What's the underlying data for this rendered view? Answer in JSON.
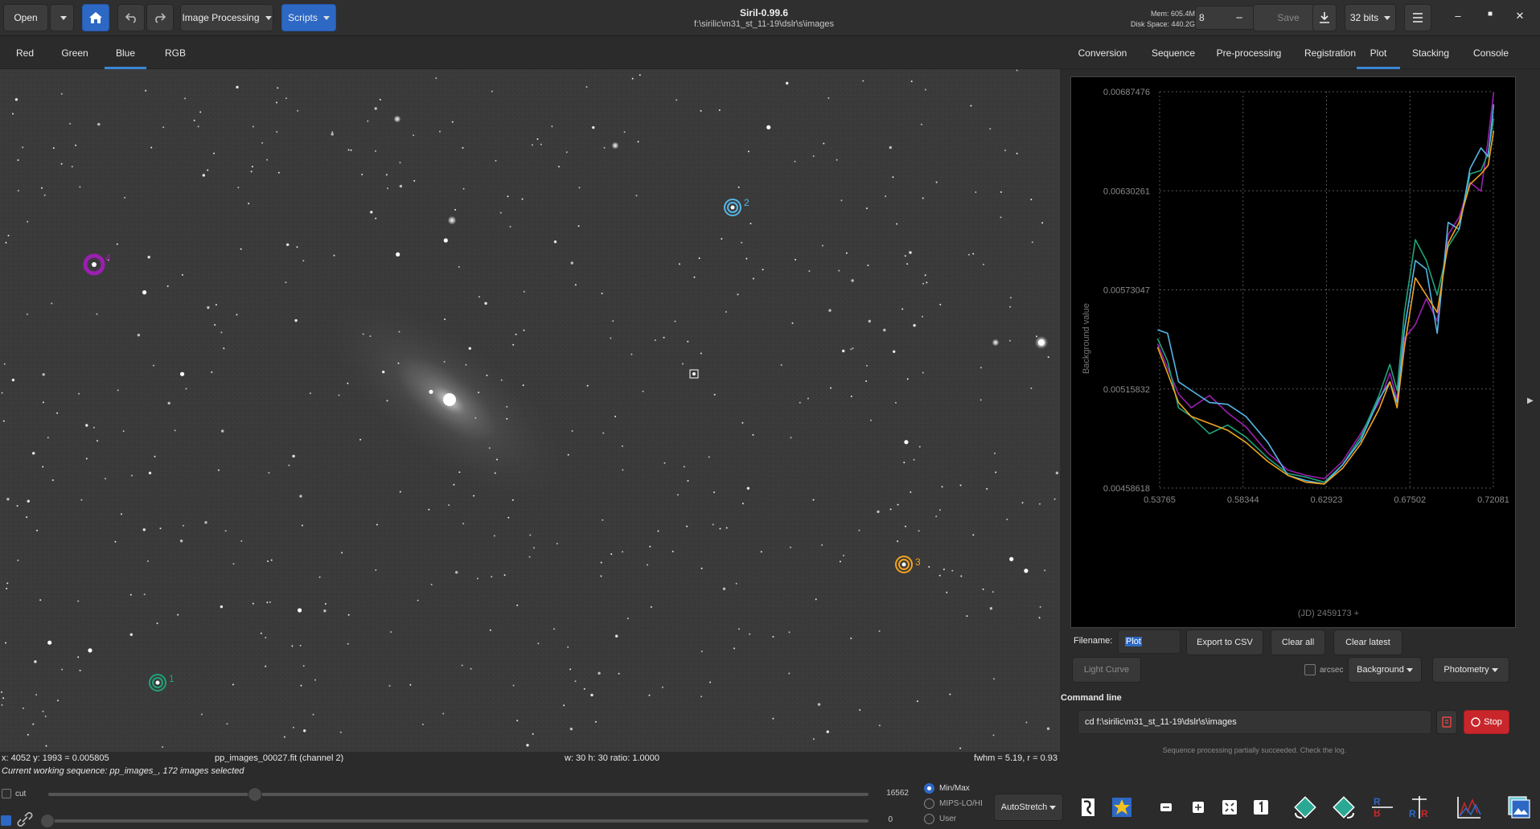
{
  "header": {
    "open_label": "Open",
    "image_processing_label": "Image Processing",
    "scripts_label": "Scripts",
    "app_title": "Siril-0.99.6",
    "working_dir": "f:\\sirilic\\m31_st_11-19\\dslr\\s\\images",
    "mem": "Mem: 605.4M",
    "disk": "Disk Space: 440.2G",
    "threads_value": "8",
    "save_label": "Save",
    "bits_label": "32 bits"
  },
  "channel_tabs": [
    "Red",
    "Green",
    "Blue",
    "RGB"
  ],
  "active_channel_tab": "Blue",
  "right_tabs": [
    "Conversion",
    "Sequence",
    "Pre-processing",
    "Registration",
    "Plot",
    "Stacking",
    "Console"
  ],
  "active_right_tab": "Plot",
  "star_labels": {
    "s1": "1",
    "s2": "2",
    "s3": "3",
    "s4": "4"
  },
  "status_bar": {
    "cursor": "x: 4052 y: 1993 = 0.005805",
    "file": "pp_images_00027.fit (channel 2)",
    "selection": "w: 30 h: 30 ratio: 1.0000",
    "fwhm": "fwhm = 5.19, r = 0.93"
  },
  "plot_controls": {
    "filename_label": "Filename:",
    "filename_value": "Plot",
    "export_csv": "Export to CSV",
    "clear_all": "Clear all",
    "clear_latest": "Clear latest",
    "light_curve": "Light Curve",
    "arcsec": "arcsec",
    "background_dropdown": "Background",
    "photometry_dropdown": "Photometry"
  },
  "command_line": {
    "label": "Command line",
    "value": "cd f:\\sirilic\\m31_st_11-19\\dslr\\s\\images",
    "stop_label": "Stop",
    "message": "Sequence processing partially succeeded. Check the log."
  },
  "bottom": {
    "working_sequence": "Current working sequence: pp_images_, 172 images selected",
    "cut_label": "cut",
    "hi_value": "16562",
    "lo_value": "0",
    "minmax_label": "Min/Max",
    "mips_label": "MIPS-LO/HI",
    "user_label": "User",
    "stretch_label": "AutoStretch"
  },
  "colors": {
    "accent": "#2d68c4",
    "stop": "#c8262b",
    "star1": "#1fa37a",
    "star2": "#55b6e6",
    "star3": "#f2a41f",
    "star4": "#9b1fb0"
  },
  "chart_data": {
    "type": "line",
    "title": "",
    "xlabel": "(JD) 2459173 +",
    "ylabel": "Background value",
    "xlim": [
      0.53765,
      0.72081
    ],
    "ylim": [
      0.00458618,
      0.00687476
    ],
    "x_ticks": [
      "0.53765",
      "0.58344",
      "0.62923",
      "0.67502",
      "0.72081"
    ],
    "y_ticks": [
      "0.00458618",
      "0.00515832",
      "0.00573047",
      "0.00630261",
      "0.00687476"
    ],
    "grid": true,
    "series": [
      {
        "color": "#9b1fb0",
        "x": [
          0.5365,
          0.542,
          0.548,
          0.555,
          0.565,
          0.575,
          0.585,
          0.597,
          0.608,
          0.618,
          0.628,
          0.638,
          0.648,
          0.658,
          0.664,
          0.668,
          0.672,
          0.678,
          0.684,
          0.69,
          0.696,
          0.702,
          0.708,
          0.714,
          0.718,
          0.721
        ],
        "values": [
          0.00542,
          0.00528,
          0.00513,
          0.00505,
          0.00512,
          0.00502,
          0.00494,
          0.00479,
          0.00469,
          0.00466,
          0.00464,
          0.00474,
          0.0049,
          0.00508,
          0.00525,
          0.0051,
          0.00545,
          0.00553,
          0.00568,
          0.00555,
          0.00605,
          0.00615,
          0.00635,
          0.0063,
          0.0066,
          0.00687
        ]
      },
      {
        "color": "#1fa37a",
        "x": [
          0.5365,
          0.542,
          0.548,
          0.555,
          0.565,
          0.575,
          0.585,
          0.597,
          0.608,
          0.618,
          0.628,
          0.638,
          0.648,
          0.658,
          0.664,
          0.668,
          0.672,
          0.678,
          0.684,
          0.69,
          0.696,
          0.702,
          0.708,
          0.714,
          0.718,
          0.721
        ],
        "values": [
          0.00545,
          0.00532,
          0.00505,
          0.005,
          0.0049,
          0.00495,
          0.00488,
          0.00476,
          0.00467,
          0.00465,
          0.00462,
          0.00472,
          0.00488,
          0.00512,
          0.0053,
          0.00515,
          0.0056,
          0.00602,
          0.0059,
          0.0057,
          0.00598,
          0.00608,
          0.0064,
          0.00642,
          0.00652,
          0.00672
        ]
      },
      {
        "color": "#55b6e6",
        "x": [
          0.5365,
          0.542,
          0.548,
          0.555,
          0.565,
          0.575,
          0.585,
          0.597,
          0.608,
          0.618,
          0.628,
          0.638,
          0.648,
          0.658,
          0.664,
          0.668,
          0.672,
          0.678,
          0.684,
          0.69,
          0.696,
          0.702,
          0.708,
          0.714,
          0.718,
          0.721
        ],
        "values": [
          0.0055,
          0.00548,
          0.0052,
          0.00515,
          0.00508,
          0.00507,
          0.005,
          0.00485,
          0.00466,
          0.00463,
          0.00461,
          0.00472,
          0.00486,
          0.0051,
          0.0052,
          0.00508,
          0.0055,
          0.0059,
          0.00585,
          0.00548,
          0.00612,
          0.00608,
          0.00643,
          0.00655,
          0.0065,
          0.0068
        ]
      },
      {
        "color": "#f2a41f",
        "x": [
          0.5365,
          0.542,
          0.548,
          0.555,
          0.565,
          0.575,
          0.585,
          0.597,
          0.608,
          0.618,
          0.628,
          0.638,
          0.648,
          0.658,
          0.664,
          0.668,
          0.672,
          0.678,
          0.684,
          0.69,
          0.696,
          0.702,
          0.708,
          0.714,
          0.718,
          0.721
        ],
        "values": [
          0.0054,
          0.00525,
          0.00508,
          0.005,
          0.00496,
          0.00492,
          0.00485,
          0.00474,
          0.00466,
          0.00462,
          0.00461,
          0.0047,
          0.00484,
          0.00504,
          0.0052,
          0.00505,
          0.0054,
          0.0058,
          0.0057,
          0.0056,
          0.006,
          0.00612,
          0.00634,
          0.0064,
          0.00645,
          0.00665
        ]
      }
    ]
  }
}
